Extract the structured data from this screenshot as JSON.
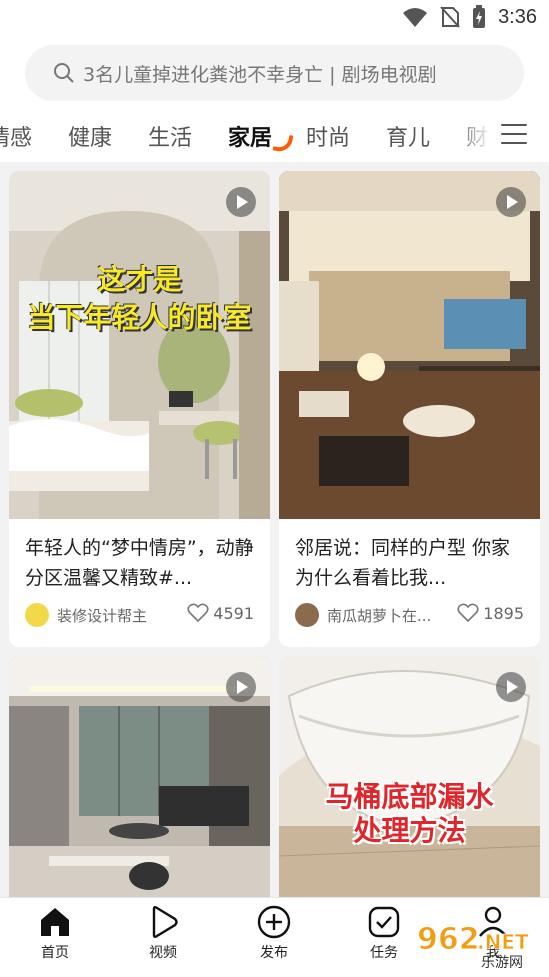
{
  "status_bar": {
    "time": "3:36",
    "icons": [
      "wifi-icon",
      "no-sim-icon",
      "battery-charging-icon"
    ]
  },
  "search": {
    "placeholder": "3名儿童掉进化粪池不幸身亡 | 剧场电视剧"
  },
  "tabs": [
    {
      "label": "情感",
      "active": false
    },
    {
      "label": "健康",
      "active": false
    },
    {
      "label": "生活",
      "active": false
    },
    {
      "label": "家居",
      "active": true
    },
    {
      "label": "时尚",
      "active": false
    },
    {
      "label": "育儿",
      "active": false
    },
    {
      "label": "财",
      "active": false
    }
  ],
  "colors": {
    "accent": "#ff5a00",
    "overlay_yellow": "#f7e92a",
    "overlay_red": "#e0262a"
  },
  "cards": [
    {
      "overlay_lines": [
        "这才是",
        "当下年轻人的卧室"
      ],
      "title": "年轻人的“梦中情房”，动静分区温馨又精致#...",
      "author": "装修设计帮主",
      "likes": "4591",
      "is_video": true
    },
    {
      "title": "邻居说：同样的户型 你家为什么看着比我...",
      "author": "南瓜胡萝卜在...",
      "likes": "1895",
      "is_video": true
    },
    {
      "is_video": true
    },
    {
      "overlay_lines": [
        "马桶底部漏水",
        "处理方法"
      ],
      "is_video": true
    }
  ],
  "bottom_nav": [
    {
      "label": "首页",
      "icon": "home-icon",
      "active": true
    },
    {
      "label": "视频",
      "icon": "video-play-icon",
      "active": false
    },
    {
      "label": "发布",
      "icon": "plus-circle-icon",
      "active": false
    },
    {
      "label": "任务",
      "icon": "checkbox-icon",
      "active": false
    },
    {
      "label": "我",
      "icon": "profile-icon",
      "active": false
    }
  ],
  "watermark": {
    "text": "962.NET",
    "subtext": "乐游网"
  }
}
